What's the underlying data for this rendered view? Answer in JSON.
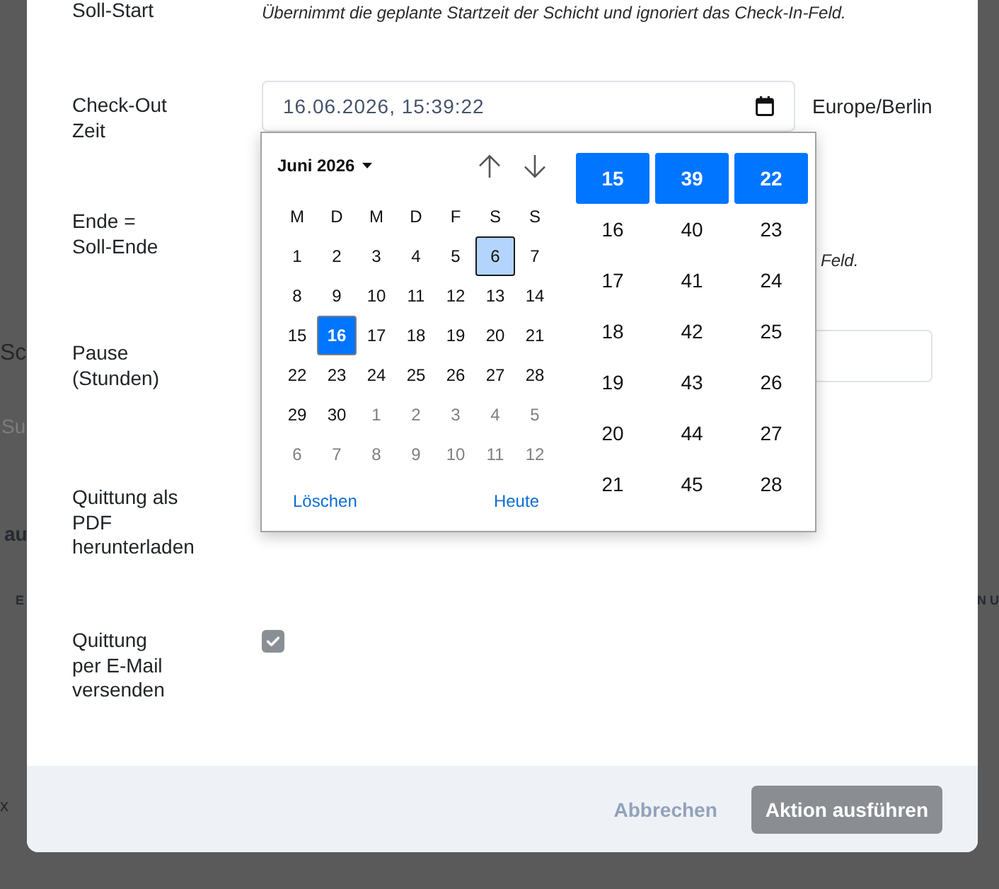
{
  "background": {
    "left_edge": [
      {
        "kind": "heading",
        "text": "Sc"
      },
      {
        "kind": "placeholder",
        "text": "Su"
      },
      {
        "kind": "strong",
        "text": "au"
      },
      {
        "kind": "column_header",
        "text": "E"
      },
      {
        "kind": "plain",
        "text": "x"
      }
    ],
    "right_edge": [
      {
        "kind": "column_header",
        "text": "N U"
      }
    ]
  },
  "dialog": {
    "rows": [
      {
        "label": "Soll-Start",
        "kind": "hint",
        "hint": "Übernimmt die geplante Startzeit der Schicht und ignoriert das Check-In-Feld."
      },
      {
        "label": "Check-Out Zeit",
        "kind": "datetime",
        "value": "16.06.2026, 15:39:22",
        "timezone": "Europe/Berlin"
      },
      {
        "label": "Ende = Soll-Ende",
        "kind": "hint",
        "hint": "Feld."
      },
      {
        "label": "Pause (Stunden)",
        "kind": "input"
      },
      {
        "label": "Quittung als PDF herunterladen",
        "kind": "blank"
      },
      {
        "label": "Quittung per E-Mail versenden",
        "kind": "checkbox",
        "checked": true
      }
    ],
    "buttons": [
      {
        "label": "Abbrechen",
        "kind": "link"
      },
      {
        "label": "Aktion ausführen",
        "kind": "primary"
      }
    ]
  },
  "date_picker": {
    "month_label": "Juni 2026",
    "weekdays": [
      "M",
      "D",
      "M",
      "D",
      "F",
      "S",
      "S"
    ],
    "days": [
      {
        "label": "1",
        "outside_month": false,
        "selected": false,
        "highlighted": false
      },
      {
        "label": "2",
        "outside_month": false,
        "selected": false,
        "highlighted": false
      },
      {
        "label": "3",
        "outside_month": false,
        "selected": false,
        "highlighted": false
      },
      {
        "label": "4",
        "outside_month": false,
        "selected": false,
        "highlighted": false
      },
      {
        "label": "5",
        "outside_month": false,
        "selected": false,
        "highlighted": false
      },
      {
        "label": "6",
        "outside_month": false,
        "selected": false,
        "highlighted": true
      },
      {
        "label": "7",
        "outside_month": false,
        "selected": false,
        "highlighted": false
      },
      {
        "label": "8",
        "outside_month": false,
        "selected": false,
        "highlighted": false
      },
      {
        "label": "9",
        "outside_month": false,
        "selected": false,
        "highlighted": false
      },
      {
        "label": "10",
        "outside_month": false,
        "selected": false,
        "highlighted": false
      },
      {
        "label": "11",
        "outside_month": false,
        "selected": false,
        "highlighted": false
      },
      {
        "label": "12",
        "outside_month": false,
        "selected": false,
        "highlighted": false
      },
      {
        "label": "13",
        "outside_month": false,
        "selected": false,
        "highlighted": false
      },
      {
        "label": "14",
        "outside_month": false,
        "selected": false,
        "highlighted": false
      },
      {
        "label": "15",
        "outside_month": false,
        "selected": false,
        "highlighted": false
      },
      {
        "label": "16",
        "outside_month": false,
        "selected": true,
        "highlighted": false
      },
      {
        "label": "17",
        "outside_month": false,
        "selected": false,
        "highlighted": false
      },
      {
        "label": "18",
        "outside_month": false,
        "selected": false,
        "highlighted": false
      },
      {
        "label": "19",
        "outside_month": false,
        "selected": false,
        "highlighted": false
      },
      {
        "label": "20",
        "outside_month": false,
        "selected": false,
        "highlighted": false
      },
      {
        "label": "21",
        "outside_month": false,
        "selected": false,
        "highlighted": false
      },
      {
        "label": "22",
        "outside_month": false,
        "selected": false,
        "highlighted": false
      },
      {
        "label": "23",
        "outside_month": false,
        "selected": false,
        "highlighted": false
      },
      {
        "label": "24",
        "outside_month": false,
        "selected": false,
        "highlighted": false
      },
      {
        "label": "25",
        "outside_month": false,
        "selected": false,
        "highlighted": false
      },
      {
        "label": "26",
        "outside_month": false,
        "selected": false,
        "highlighted": false
      },
      {
        "label": "27",
        "outside_month": false,
        "selected": false,
        "highlighted": false
      },
      {
        "label": "28",
        "outside_month": false,
        "selected": false,
        "highlighted": false
      },
      {
        "label": "29",
        "outside_month": false,
        "selected": false,
        "highlighted": false
      },
      {
        "label": "30",
        "outside_month": false,
        "selected": false,
        "highlighted": false
      },
      {
        "label": "1",
        "outside_month": true,
        "selected": false,
        "highlighted": false
      },
      {
        "label": "2",
        "outside_month": true,
        "selected": false,
        "highlighted": false
      },
      {
        "label": "3",
        "outside_month": true,
        "selected": false,
        "highlighted": false
      },
      {
        "label": "4",
        "outside_month": true,
        "selected": false,
        "highlighted": false
      },
      {
        "label": "5",
        "outside_month": true,
        "selected": false,
        "highlighted": false
      },
      {
        "label": "6",
        "outside_month": true,
        "selected": false,
        "highlighted": false
      },
      {
        "label": "7",
        "outside_month": true,
        "selected": false,
        "highlighted": false
      },
      {
        "label": "8",
        "outside_month": true,
        "selected": false,
        "highlighted": false
      },
      {
        "label": "9",
        "outside_month": true,
        "selected": false,
        "highlighted": false
      },
      {
        "label": "10",
        "outside_month": true,
        "selected": false,
        "highlighted": false
      },
      {
        "label": "11",
        "outside_month": true,
        "selected": false,
        "highlighted": false
      },
      {
        "label": "12",
        "outside_month": true,
        "selected": false,
        "highlighted": false
      }
    ],
    "clear_label": "Löschen",
    "today_label": "Heute",
    "time_columns": [
      {
        "items": [
          {
            "label": "15",
            "selected": true
          },
          {
            "label": "16",
            "selected": false
          },
          {
            "label": "17",
            "selected": false
          },
          {
            "label": "18",
            "selected": false
          },
          {
            "label": "19",
            "selected": false
          },
          {
            "label": "20",
            "selected": false
          },
          {
            "label": "21",
            "selected": false
          }
        ]
      },
      {
        "items": [
          {
            "label": "39",
            "selected": true
          },
          {
            "label": "40",
            "selected": false
          },
          {
            "label": "41",
            "selected": false
          },
          {
            "label": "42",
            "selected": false
          },
          {
            "label": "43",
            "selected": false
          },
          {
            "label": "44",
            "selected": false
          },
          {
            "label": "45",
            "selected": false
          }
        ]
      },
      {
        "items": [
          {
            "label": "22",
            "selected": true
          },
          {
            "label": "23",
            "selected": false
          },
          {
            "label": "24",
            "selected": false
          },
          {
            "label": "25",
            "selected": false
          },
          {
            "label": "26",
            "selected": false
          },
          {
            "label": "27",
            "selected": false
          },
          {
            "label": "28",
            "selected": false
          }
        ]
      }
    ]
  }
}
